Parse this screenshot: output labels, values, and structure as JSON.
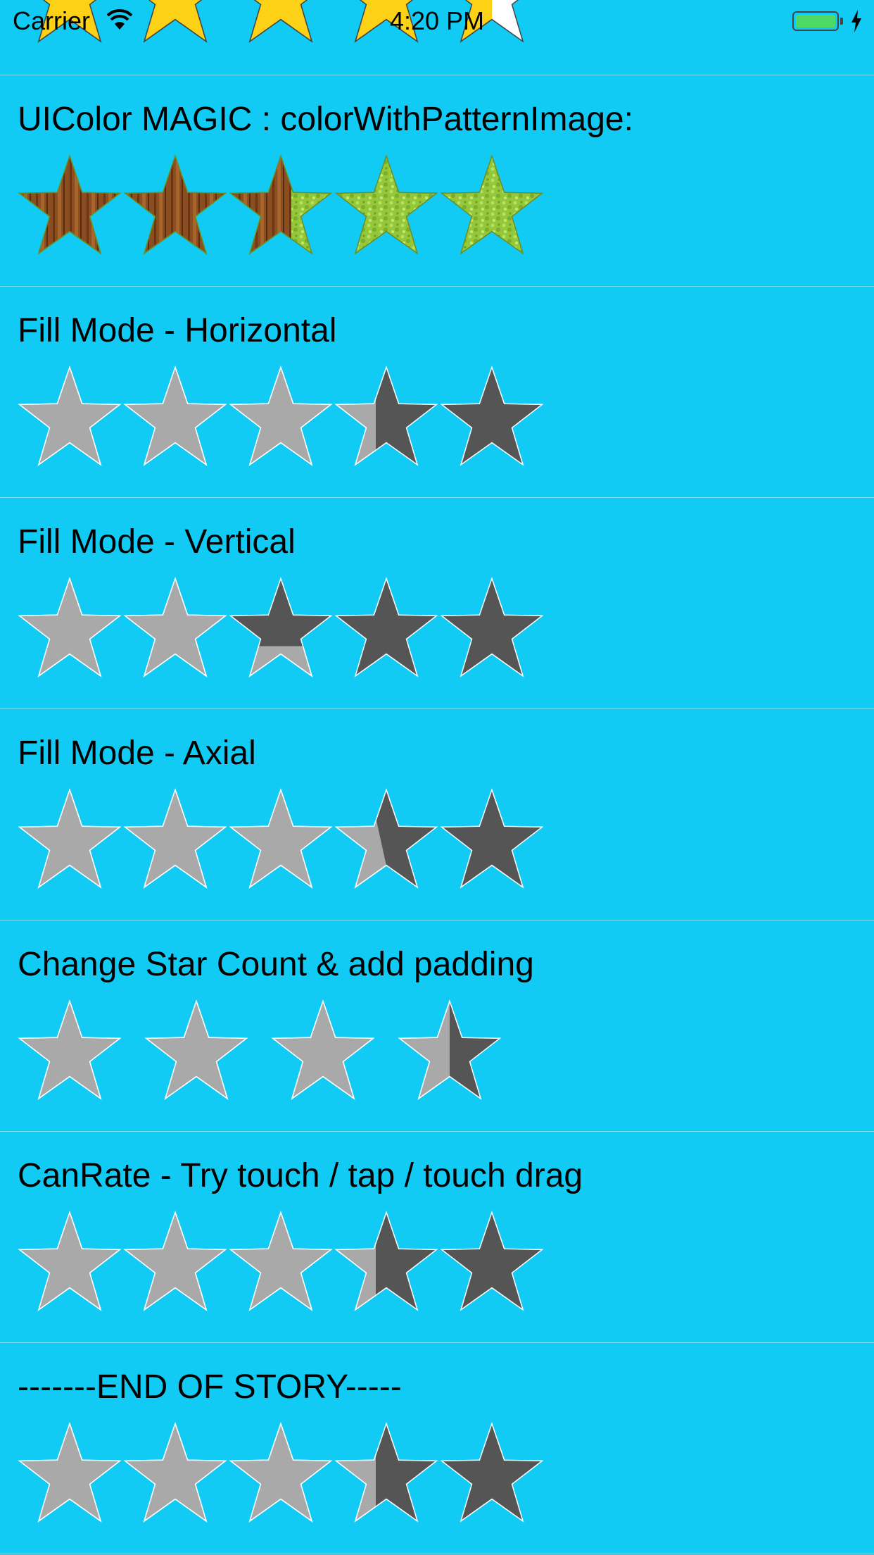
{
  "status_bar": {
    "carrier": "Carrier",
    "time": "4:20 PM",
    "battery_level": 1.0,
    "wifi_icon": "wifi-icon",
    "charging_icon": "bolt-icon"
  },
  "colors": {
    "background": "#12CBF5",
    "empty_star": "#A9A9A9",
    "filled_star": "#555555",
    "gold_star": "#FDD116",
    "star_border": "#FFFFFF",
    "wood_star": "#8B4E22",
    "grass_star": "#9ACD32"
  },
  "top_cell": {
    "star_count": 5,
    "rating": 4.5,
    "style": "gold"
  },
  "cells": [
    {
      "title": "UIColor MAGIC : colorWithPatternImage:",
      "star_count": 5,
      "rating": 2.6,
      "fill_mode": "horizontal",
      "style": "pattern",
      "filled_pattern": "wood",
      "empty_pattern": "grass"
    },
    {
      "title": "Fill Mode - Horizontal",
      "star_count": 5,
      "rating": 3.4,
      "fill_mode": "horizontal",
      "style": "plain"
    },
    {
      "title": "Fill Mode - Vertical",
      "star_count": 5,
      "rating": 2.35,
      "fill_mode": "vertical",
      "style": "plain"
    },
    {
      "title": "Fill Mode - Axial",
      "star_count": 5,
      "rating": 3.4,
      "fill_mode": "axial",
      "style": "plain"
    },
    {
      "title": "Change Star Count & add padding",
      "star_count": 4,
      "rating": 3.5,
      "fill_mode": "horizontal",
      "style": "plain",
      "padding": true
    },
    {
      "title": "CanRate - Try touch / tap / touch drag",
      "star_count": 5,
      "rating": 3.4,
      "fill_mode": "horizontal",
      "style": "plain"
    },
    {
      "title": "-------END OF STORY-----",
      "star_count": 5,
      "rating": 3.4,
      "fill_mode": "horizontal",
      "style": "plain"
    }
  ]
}
